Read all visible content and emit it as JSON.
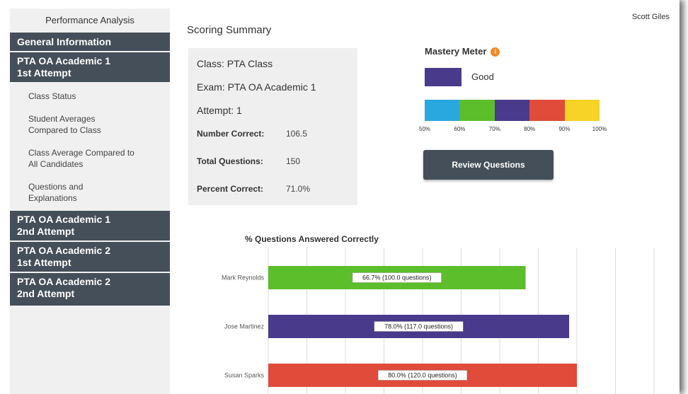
{
  "user": {
    "name": "Scott Giles"
  },
  "sidebar": {
    "title": "Performance Analysis",
    "sections": [
      {
        "label": "General Information"
      },
      {
        "label": "PTA OA Academic 1\n1st Attempt"
      },
      {
        "label": "PTA OA Academic 1\n2nd Attempt"
      },
      {
        "label": "PTA OA Academic 2\n1st Attempt"
      },
      {
        "label": "PTA OA Academic 2\n2nd Attempt"
      }
    ],
    "items": [
      {
        "label": "Class Status"
      },
      {
        "label": "Student Averages Compared to Class"
      },
      {
        "label": "Class Average Compared to All Candidates"
      },
      {
        "label": "Questions and Explanations"
      }
    ]
  },
  "summary": {
    "title": "Scoring Summary",
    "class_line": "Class: PTA Class",
    "exam_line": "Exam: PTA OA Academic 1",
    "attempt_line": "Attempt: 1",
    "rows": [
      {
        "label": "Number Correct:",
        "value": "106.5"
      },
      {
        "label": "Total Questions:",
        "value": "150"
      },
      {
        "label": "Percent Correct:",
        "value": "71.0%"
      }
    ]
  },
  "mastery": {
    "title": "Mastery Meter",
    "info_icon": "info-icon",
    "level_label": "Good",
    "level_color": "#4a3a8c",
    "bands": [
      "#29a8e0",
      "#5cbe2a",
      "#4a3a8c",
      "#e04b3a",
      "#f5d327"
    ],
    "ticks": [
      "50%",
      "60%",
      "70%",
      "80%",
      "90%",
      "100%"
    ]
  },
  "review_button": {
    "label": "Review Questions"
  },
  "chart_data": {
    "type": "bar",
    "orientation": "horizontal",
    "title": "% Questions Answered Correctly",
    "categories": [
      "Mark Reynolds",
      "Jose Martinez",
      "Susan Sparks"
    ],
    "values": [
      66.7,
      78.0,
      80.0
    ],
    "data_labels": [
      "66.7% (100.0 questions)",
      "78.0% (117.0 questions)",
      "80.0% (120.0 questions)"
    ],
    "colors": [
      "#5cbe2a",
      "#4a3a8c",
      "#e04b3a"
    ],
    "xlim": [
      0,
      100
    ],
    "grid": true
  }
}
